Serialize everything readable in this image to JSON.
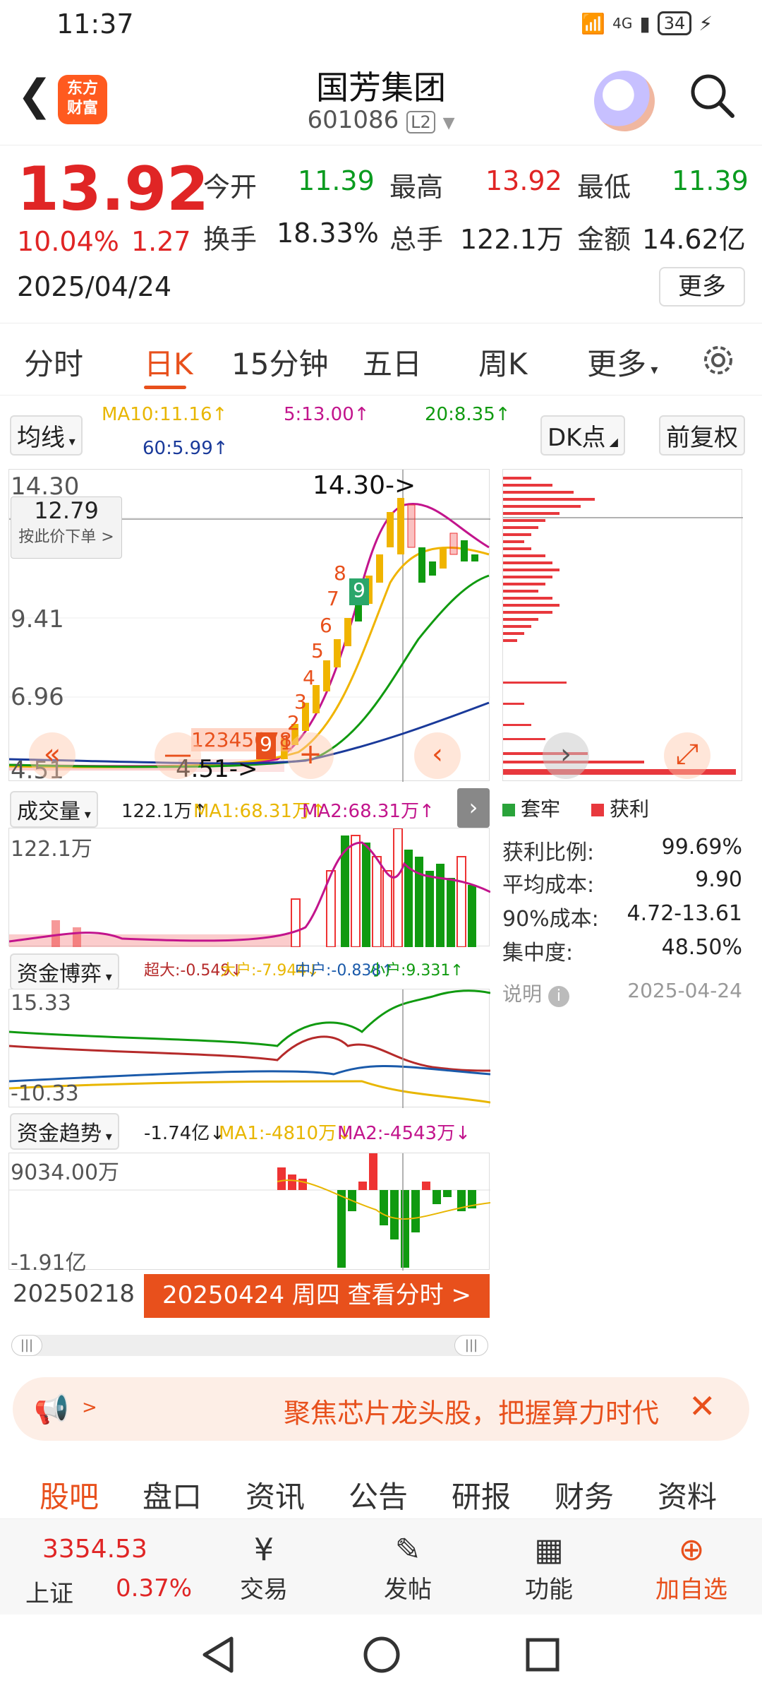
{
  "status": {
    "time": "11:37",
    "battery": "34",
    "net": "4G"
  },
  "header": {
    "logo_line1": "东方",
    "logo_line2": "财富",
    "title": "国芳集团",
    "code": "601086",
    "level": "L2"
  },
  "quote": {
    "price": "13.92",
    "pct": "10.04%",
    "change": "1.27",
    "date": "2025/04/24",
    "open_label": "今开",
    "open": "11.39",
    "high_label": "最高",
    "high": "13.92",
    "low_label": "最低",
    "low": "11.39",
    "turnover_label": "换手",
    "turnover": "18.33%",
    "volume_label": "总手",
    "volume": "122.1万",
    "amount_label": "金额",
    "amount": "14.62亿",
    "more": "更多"
  },
  "tabs": [
    "分时",
    "日K",
    "15分钟",
    "五日",
    "周K",
    "更多"
  ],
  "kline": {
    "ma_select": "均线",
    "ma10": "MA10:11.16↑",
    "ma5": "5:13.00↑",
    "ma20": "20:8.35↑",
    "ma60": "60:5.99↑",
    "dk": "DK点",
    "fuquan": "前复权",
    "y_high": "14.30",
    "y_mid1": "9.41",
    "y_mid2": "6.96",
    "y_low": "4.51",
    "max_marker": "14.30->",
    "min_marker": "4.51->",
    "cross_price": "12.79",
    "cross_hint": "按此价下单 >",
    "seq1": "12345678",
    "seq9": "9",
    "seq_up": [
      "8",
      "7",
      "6",
      "5",
      "4",
      "3",
      "2",
      "1"
    ],
    "seq_up9": "9"
  },
  "chip": {
    "legend_trap": "套牢",
    "legend_profit": "获利",
    "stats": [
      {
        "label": "获利比例:",
        "value": "99.69%"
      },
      {
        "label": "平均成本:",
        "value": "9.90"
      },
      {
        "label": "90%成本:",
        "value": "4.72-13.61"
      },
      {
        "label": "集中度:",
        "value": "48.50%"
      }
    ],
    "note": "说明",
    "date": "2025-04-24"
  },
  "volume": {
    "select": "成交量",
    "value": "122.1万↑",
    "ma1": "MA1:68.31万↑",
    "ma2": "MA2:68.31万↑",
    "y_top": "122.1万"
  },
  "capital": {
    "select": "资金博弈",
    "super": "超大:-0.549↓",
    "big": "大户:-7.944↓",
    "mid": "中户:-0.838↑",
    "small": "小户:9.331↑",
    "y_top": "15.33",
    "y_bot": "-10.33"
  },
  "trend": {
    "select": "资金趋势",
    "value": "-1.74亿↓",
    "ma1": "MA1:-4810万↓",
    "ma2": "MA2:-4543万↓",
    "y_top": "9034.00万",
    "y_bot": "-1.91亿"
  },
  "date_row": {
    "start": "20250218",
    "cta": "20250424 周四 查看分时 >"
  },
  "banner": {
    "text": "聚焦芯片龙头股，把握算力时代"
  },
  "bottom_tabs": [
    "股吧",
    "盘口",
    "资讯",
    "公告",
    "研报",
    "财务",
    "资料"
  ],
  "toolbar": {
    "index_value": "3354.53",
    "index_name": "上证",
    "index_pct": "0.37%",
    "trade": "交易",
    "post": "发帖",
    "func": "功能",
    "add": "加自选"
  },
  "colors": {
    "accent": "#e8501c",
    "up": "#e02525",
    "down": "#0a9b1f"
  }
}
